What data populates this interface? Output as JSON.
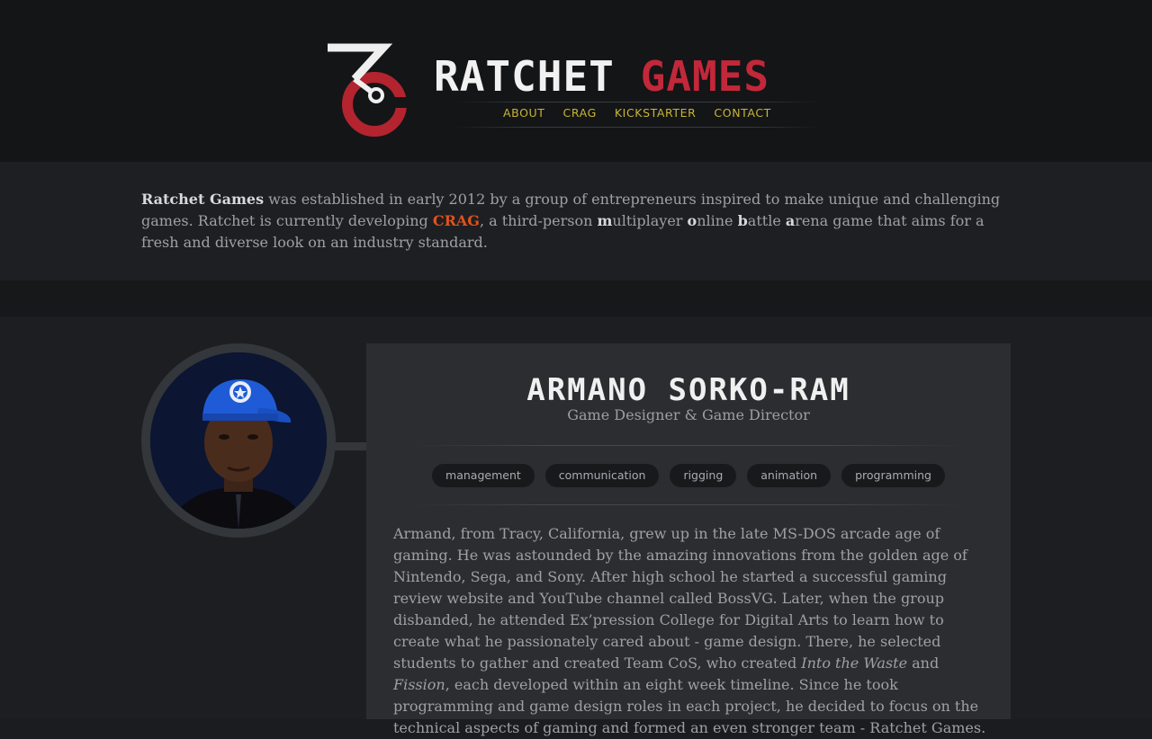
{
  "brand": {
    "word1": "RATCHET",
    "word2": "GAMES"
  },
  "nav": [
    "ABOUT",
    "CRAG",
    "KICKSTARTER",
    "CONTACT"
  ],
  "intro": {
    "company": "Ratchet Games",
    "text1": " was established in early 2012 by a group of entrepreneurs inspired to make unique and challenging games. Ratchet is currently developing ",
    "crag": "CRAG",
    "text2": ", a third-person ",
    "m": "m",
    "m_rest": "ultiplayer ",
    "o": "o",
    "o_rest": "nline ",
    "b": "b",
    "b_rest": "attle ",
    "a": "a",
    "a_rest": "rena game that aims for a fresh and diverse look on an industry standard."
  },
  "member": {
    "name": "ARMANO SORKO-RAM",
    "role": "Game Designer & Game Director",
    "skills": [
      "management",
      "communication",
      "rigging",
      "animation",
      "programming"
    ],
    "bio1": "Armand, from Tracy, California, grew up in the late MS-DOS arcade age of gaming. He was astounded by the amazing innovations from the golden age of Nintendo, Sega, and Sony. After high school he started a successful gaming review website and YouTube channel called BossVG. Later, when the group disbanded, he attended Ex’pression College for Digital Arts to learn how to create what he passionately cared about - game design. There, he selected students to gather and created Team CoS, who created ",
    "italic1": "Into the Waste",
    "bio2": " and ",
    "italic2": "Fission",
    "bio3": ", each developed within an eight week timeline. Since he took programming and game design roles in each project, he decided to focus on the technical aspects of gaming and formed an even stronger team - Ratchet Games."
  },
  "colors": {
    "accent_red": "#c2283a",
    "nav_yellow": "#c8b534",
    "crag_orange": "#e0521c"
  },
  "icons": [
    "ratchet-logo-icon",
    "avatar-photo"
  ]
}
